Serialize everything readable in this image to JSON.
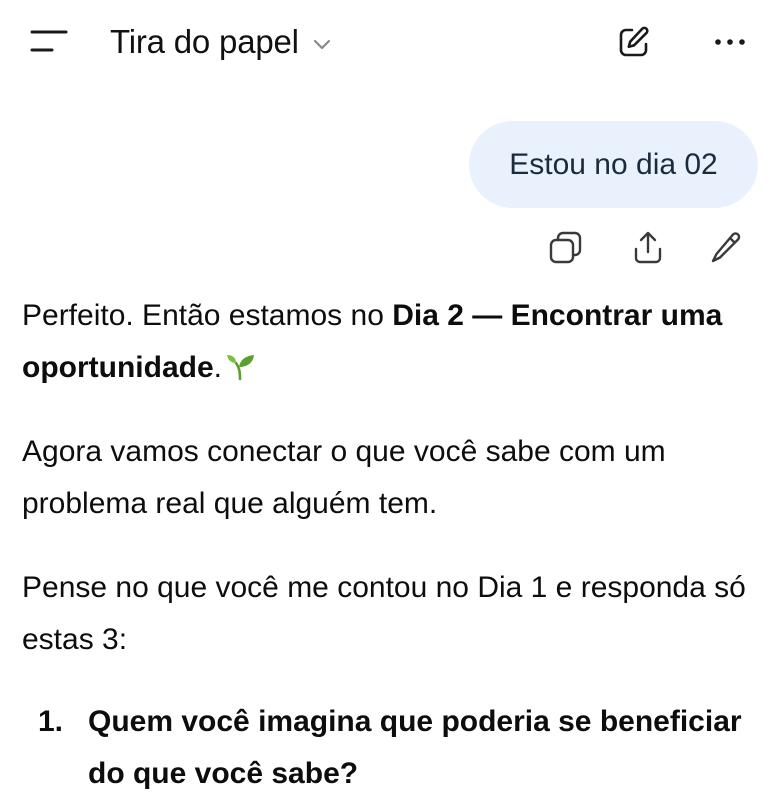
{
  "header": {
    "title": "Tira do papel",
    "icons": {
      "menu": "sidebar-menu-icon",
      "chevron": "chevron-down-icon",
      "new_chat": "compose-icon",
      "more": "more-horizontal-icon"
    }
  },
  "user_message": {
    "text": "Estou no dia 02",
    "bubble_color": "#e9f1fd"
  },
  "message_actions": {
    "icons": [
      "copy-icon",
      "share-icon",
      "edit-icon"
    ]
  },
  "reply": {
    "p1_prefix": "Perfeito. Então estamos no ",
    "p1_bold": "Dia 2 — Encontrar uma oportunidade",
    "p1_suffix": ".",
    "p1_emoji": "seedling-icon",
    "p2": "Agora vamos conectar o que você sabe com um problema real que alguém tem.",
    "p3": "Pense no que você me contou no Dia 1 e responda só estas 3:",
    "list": [
      {
        "number": "1.",
        "text": "Quem você imagina que poderia se beneficiar do que você sabe?"
      }
    ]
  }
}
